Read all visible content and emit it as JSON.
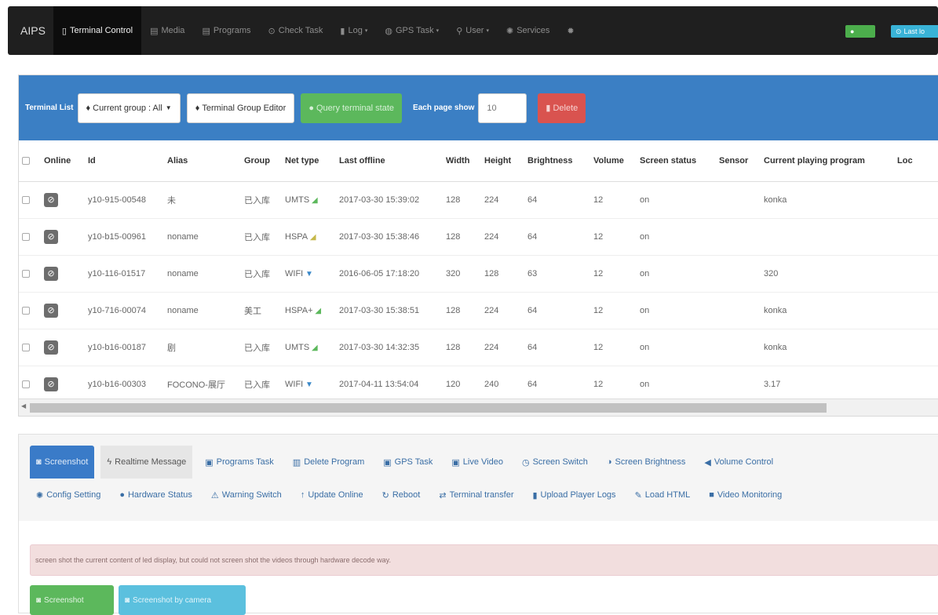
{
  "nav": {
    "brand": "AIPS",
    "items": [
      {
        "label": "Terminal Control",
        "icon": "mobile-icon",
        "glyph": "▯"
      },
      {
        "label": "Media",
        "icon": "film-icon",
        "glyph": "▤"
      },
      {
        "label": "Programs",
        "icon": "list-icon",
        "glyph": "▤"
      },
      {
        "label": "Check Task",
        "icon": "check-circle-icon",
        "glyph": "⊙"
      },
      {
        "label": "Log",
        "icon": "file-icon",
        "glyph": "▮",
        "caret": true
      },
      {
        "label": "GPS Task",
        "icon": "globe-icon",
        "glyph": "◍",
        "caret": true
      },
      {
        "label": "User",
        "icon": "user-icon",
        "glyph": "⚲",
        "caret": true
      },
      {
        "label": "Services",
        "icon": "cog-icon",
        "glyph": "✺"
      },
      {
        "label": "",
        "icon": "settings-icon",
        "glyph": "✹"
      }
    ],
    "right_user": "≗",
    "right_user_glyph": "👤",
    "right_logout": "Last lo",
    "right_logout_glyph": "⊙"
  },
  "toolbar": {
    "label": "Terminal List",
    "group_btn": "Current group : All",
    "group_editor_btn": "Terminal Group Editor",
    "query_btn": "Query terminal state",
    "page_label": "Each page show",
    "page_value": "10",
    "delete_btn": "Delete"
  },
  "table": {
    "headers": [
      "",
      "Online",
      "Id",
      "Alias",
      "Group",
      "Net type",
      "Last offline",
      "Width",
      "Height",
      "Brightness",
      "Volume",
      "Screen status",
      "Sensor",
      "Current playing program",
      "Loc"
    ],
    "rows": [
      {
        "id": "y10-915-00548",
        "alias": "未",
        "group": "已入库",
        "net": "UMTS",
        "signal": "green",
        "last_offline": "2017-03-30 15:39:02",
        "width": "128",
        "height": "224",
        "brightness": "64",
        "volume": "12",
        "screen": "on",
        "sensor": "",
        "program": "konka"
      },
      {
        "id": "y10-b15-00961",
        "alias": "noname",
        "group": "已入库",
        "net": "HSPA",
        "signal": "yellow",
        "last_offline": "2017-03-30 15:38:46",
        "width": "128",
        "height": "224",
        "brightness": "64",
        "volume": "12",
        "screen": "on",
        "sensor": "",
        "program": ""
      },
      {
        "id": "y10-116-01517",
        "alias": "noname",
        "group": "已入库",
        "net": "WIFI",
        "signal": "wifi",
        "last_offline": "2016-06-05 17:18:20",
        "width": "320",
        "height": "128",
        "brightness": "63",
        "volume": "12",
        "screen": "on",
        "sensor": "",
        "program": "320"
      },
      {
        "id": "y10-716-00074",
        "alias": "noname",
        "group": "美工",
        "net": "HSPA+",
        "signal": "green",
        "last_offline": "2017-03-30 15:38:51",
        "width": "128",
        "height": "224",
        "brightness": "64",
        "volume": "12",
        "screen": "on",
        "sensor": "",
        "program": "konka"
      },
      {
        "id": "y10-b16-00187",
        "alias": "剧",
        "group": "已入库",
        "net": "UMTS",
        "signal": "green",
        "last_offline": "2017-03-30 14:32:35",
        "width": "128",
        "height": "224",
        "brightness": "64",
        "volume": "12",
        "screen": "on",
        "sensor": "",
        "program": "konka"
      },
      {
        "id": "y10-b16-00303",
        "alias": "FOCONO-展厅",
        "group": "已入库",
        "net": "WIFI",
        "signal": "wifi",
        "last_offline": "2017-04-11 13:54:04",
        "width": "120",
        "height": "240",
        "brightness": "64",
        "volume": "12",
        "screen": "on",
        "sensor": "",
        "program": "3.17"
      }
    ]
  },
  "functions": {
    "row1": [
      {
        "label": "Screenshot",
        "icon": "camera-icon",
        "glyph": "◙",
        "state": "active"
      },
      {
        "label": "Realtime Message",
        "icon": "bolt-icon",
        "glyph": "ϟ",
        "state": "hover"
      },
      {
        "label": "Programs Task",
        "icon": "save-icon",
        "glyph": "▣",
        "state": ""
      },
      {
        "label": "Delete Program",
        "icon": "trash-icon",
        "glyph": "▥",
        "state": ""
      },
      {
        "label": "GPS Task",
        "icon": "save-icon",
        "glyph": "▣",
        "state": ""
      },
      {
        "label": "Live Video",
        "icon": "save-icon",
        "glyph": "▣",
        "state": ""
      },
      {
        "label": "Screen Switch",
        "icon": "power-icon",
        "glyph": "◷",
        "state": ""
      },
      {
        "label": "Screen Brightness",
        "icon": "contrast-icon",
        "glyph": "◑",
        "state": ""
      },
      {
        "label": "Volume Control",
        "icon": "volume-icon",
        "glyph": "◀",
        "state": ""
      }
    ],
    "row2": [
      {
        "label": "Config Setting",
        "icon": "cog-icon",
        "glyph": "✺"
      },
      {
        "label": "Hardware Status",
        "icon": "info-icon",
        "glyph": "●"
      },
      {
        "label": "Warning Switch",
        "icon": "warning-icon",
        "glyph": "⚠"
      },
      {
        "label": "Update Online",
        "icon": "arrow-up-icon",
        "glyph": "↑"
      },
      {
        "label": "Reboot",
        "icon": "refresh-icon",
        "glyph": "↻"
      },
      {
        "label": "Terminal transfer",
        "icon": "transfer-icon",
        "glyph": "⇄"
      },
      {
        "label": "Upload Player Logs",
        "icon": "file-icon",
        "glyph": "▮"
      },
      {
        "label": "Load HTML",
        "icon": "pencil-icon",
        "glyph": "✎"
      },
      {
        "label": "Video Monitoring",
        "icon": "video-icon",
        "glyph": "■"
      }
    ],
    "info": "screen shot the current content of led display, but could not screen shot the videos through hardware decode way.",
    "btn_screenshot": "Screenshot",
    "btn_camera": "Screenshot by camera"
  }
}
